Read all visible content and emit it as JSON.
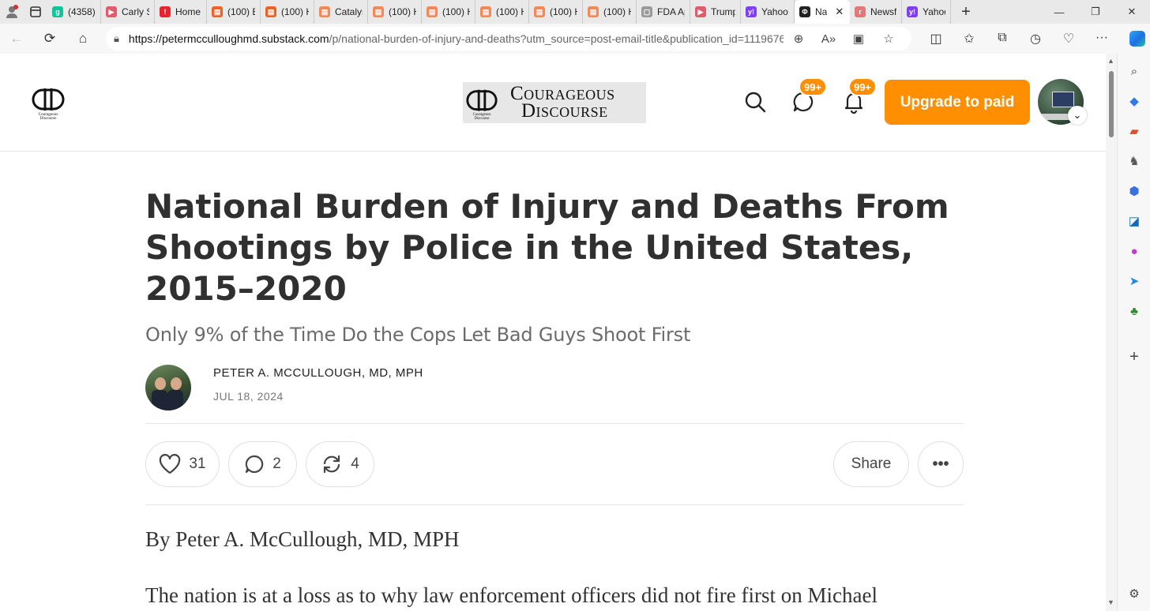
{
  "browser": {
    "tabs": [
      {
        "title": "(4358)",
        "color": "#15c39a",
        "glyph": "g"
      },
      {
        "title": "Carly Sh",
        "color": "#e05b6c",
        "glyph": "▶"
      },
      {
        "title": "Home",
        "color": "#e3262e",
        "glyph": "!"
      },
      {
        "title": "(100) E",
        "color": "#f0602a",
        "glyph": "▤"
      },
      {
        "title": "(100) H",
        "color": "#f0602a",
        "glyph": "▤"
      },
      {
        "title": "Catalys",
        "color": "#f08a5a",
        "glyph": "▤"
      },
      {
        "title": "(100) H",
        "color": "#f08a5a",
        "glyph": "▤"
      },
      {
        "title": "(100) H",
        "color": "#f08a5a",
        "glyph": "▤"
      },
      {
        "title": "(100) H",
        "color": "#f08a5a",
        "glyph": "▤"
      },
      {
        "title": "(100) H",
        "color": "#f08a5a",
        "glyph": "▤"
      },
      {
        "title": "(100) H",
        "color": "#f08a5a",
        "glyph": "▤"
      },
      {
        "title": "FDA Ap",
        "color": "#9a9a9a",
        "glyph": "▢"
      },
      {
        "title": "Trump",
        "color": "#e05b6c",
        "glyph": "▶"
      },
      {
        "title": "Yahoo",
        "color": "#7e3ff2",
        "glyph": "y!"
      },
      {
        "title": "Na",
        "color": "#222222",
        "glyph": "Φ",
        "active": true
      },
      {
        "title": "Newsfe",
        "color": "#e07a7a",
        "glyph": "r"
      },
      {
        "title": "Yahoo",
        "color": "#7e3ff2",
        "glyph": "y!"
      }
    ],
    "url_host": "https://petermcculloughmd.substack.com",
    "url_path": "/p/national-burden-of-injury-and-deaths?utm_source=post-email-title&publication_id=1119676..."
  },
  "header": {
    "brand_line1": "Courageous",
    "brand_line2": "Discourse",
    "logo_caption_1": "Courageous",
    "logo_caption_2": "Discourse",
    "chat_badge": "99+",
    "notif_badge": "99+",
    "upgrade_label": "Upgrade to paid",
    "accent_color": "#ff8f00"
  },
  "article": {
    "title": "National Burden of Injury and Deaths From Shootings by Police in the United States, 2015–2020",
    "subtitle": "Only 9% of the Time Do the Cops Let Bad Guys Shoot First",
    "author": "PETER A. MCCULLOUGH, MD, MPH",
    "date": "JUL 18, 2024",
    "likes": "31",
    "comments": "2",
    "restacks": "4",
    "share_label": "Share",
    "more_label": "•••",
    "byline_text": "By Peter A. McCullough, MD, MPH",
    "first_paragraph": "The nation is at a loss as to why law enforcement officers did not fire first on Michael"
  }
}
